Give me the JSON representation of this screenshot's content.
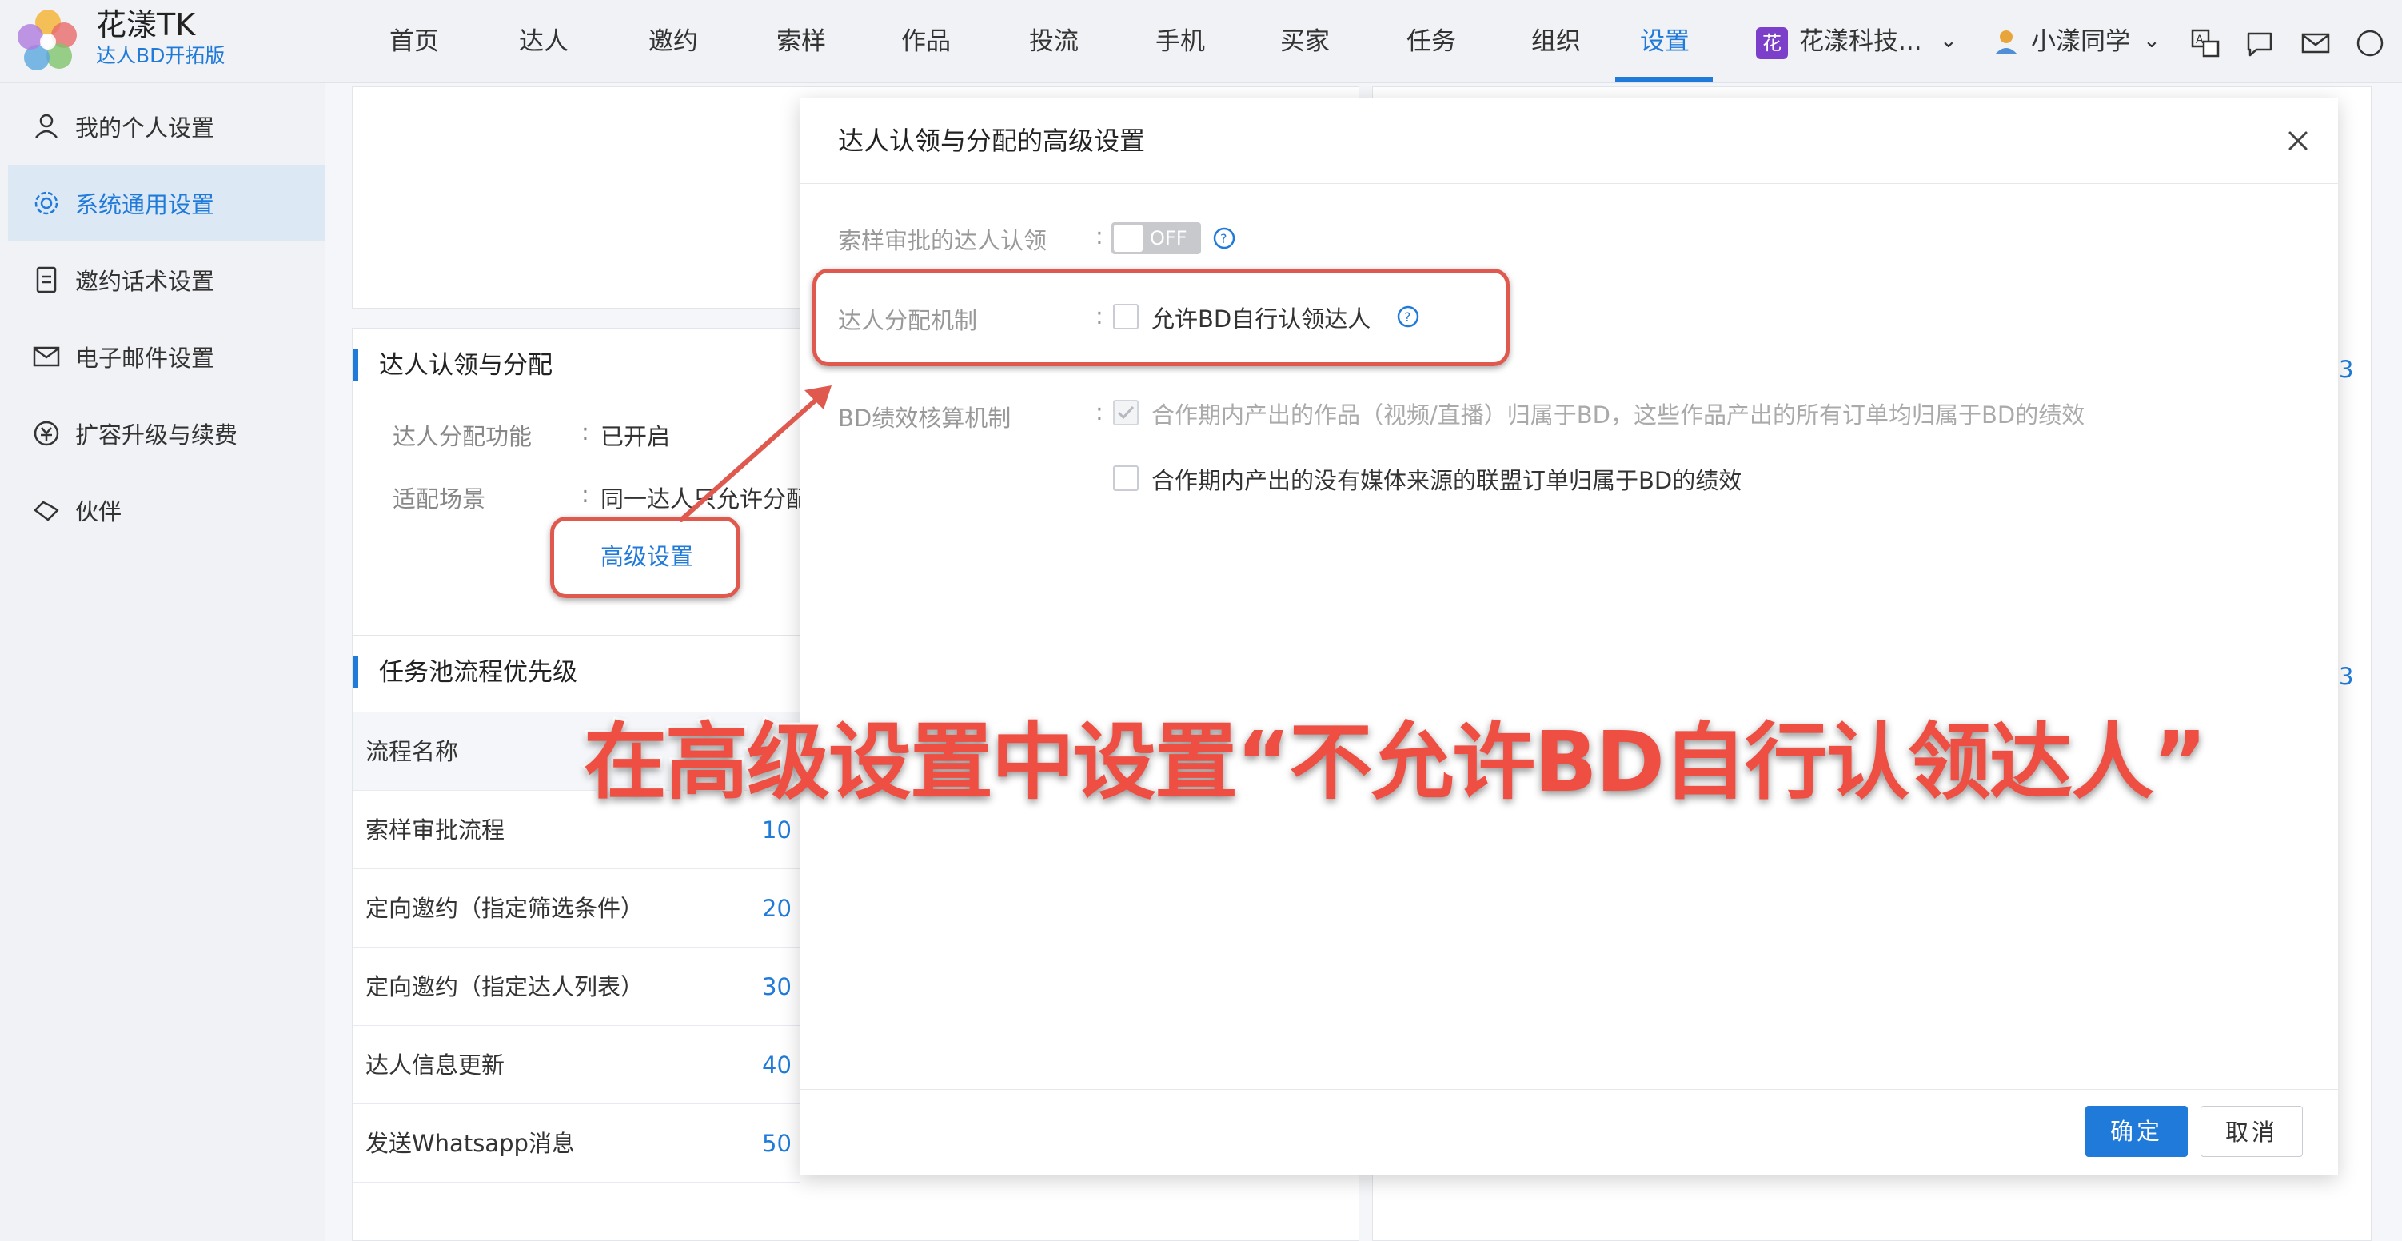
{
  "brand": {
    "name": "花漾TK",
    "subtitle": "达人BD开拓版"
  },
  "nav": {
    "items": [
      "首页",
      "达人",
      "邀约",
      "索样",
      "作品",
      "投流",
      "手机",
      "买家",
      "任务",
      "组织",
      "设置"
    ],
    "active": "设置",
    "org_badge": "花",
    "org_name": "花漾科技...",
    "user_name": "小漾同学"
  },
  "sidebar": {
    "items": [
      "我的个人设置",
      "系统通用设置",
      "邀约话术设置",
      "电子邮件设置",
      "扩容升级与续费",
      "伙伴"
    ],
    "active": "系统通用设置"
  },
  "background": {
    "claim_section": {
      "title": "达人认领与分配",
      "k1": "达人分配功能",
      "v1": "已开启",
      "k2": "适配场景",
      "v2": "同一达人只允许分配",
      "advanced_link": "高级设置"
    },
    "pool_section": {
      "title": "任务池流程优先级",
      "header": "流程名称",
      "rows": [
        {
          "name": "索样审批流程",
          "priority": "10"
        },
        {
          "name": "定向邀约（指定筛选条件）",
          "priority": "20"
        },
        {
          "name": "定向邀约（指定达人列表）",
          "priority": "30"
        },
        {
          "name": "达人信息更新",
          "priority": "40"
        },
        {
          "name": "发送Whatsapp消息",
          "priority": "50"
        }
      ]
    },
    "right_fragments": [
      "3",
      "3"
    ]
  },
  "modal": {
    "title": "达人认领与分配的高级设置",
    "field1": {
      "label": "索样审批的达人认领",
      "toggle": "OFF"
    },
    "field2": {
      "label": "达人分配机制",
      "option": "允许BD自行认领达人",
      "checked": false
    },
    "field3": {
      "label": "BD绩效核算机制",
      "option1": "合作期内产出的作品（视频/直播）归属于BD，这些作品产出的所有订单均归属于BD的绩效",
      "option1_checked": true,
      "option2": "合作期内产出的没有媒体来源的联盟订单归属于BD的绩效",
      "option2_checked": false
    },
    "ok": "确定",
    "cancel": "取消"
  },
  "annotation": {
    "caption": "在高级设置中设置“不允许BD自行认领达人”",
    "color": "#e0594e"
  },
  "colors": {
    "accent": "#1f7ad9",
    "annotation": "#e0594e",
    "org_badge": "#7b3fc9"
  }
}
